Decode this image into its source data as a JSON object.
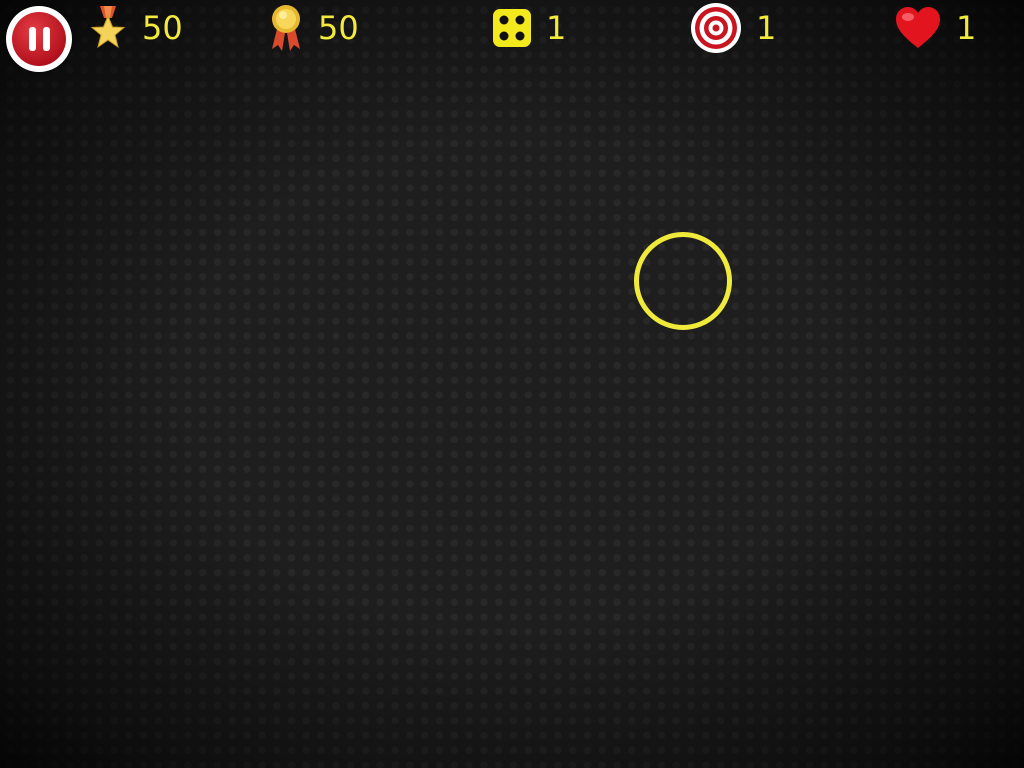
{
  "hud": {
    "pause": {
      "icon": "pause-icon"
    },
    "stars": {
      "icon": "star-medal-icon",
      "value": "50"
    },
    "medals": {
      "icon": "gold-medal-icon",
      "value": "50"
    },
    "dice": {
      "icon": "dice-icon",
      "value": "1"
    },
    "target": {
      "icon": "target-icon",
      "value": "1"
    },
    "lives": {
      "icon": "heart-icon",
      "value": "1"
    }
  },
  "colors": {
    "accent": "#f3ea3c",
    "pause": "#c8151f",
    "background": "#1e1e1e"
  },
  "playfield": {
    "target_ring": {
      "color": "#f0ea3a"
    }
  }
}
